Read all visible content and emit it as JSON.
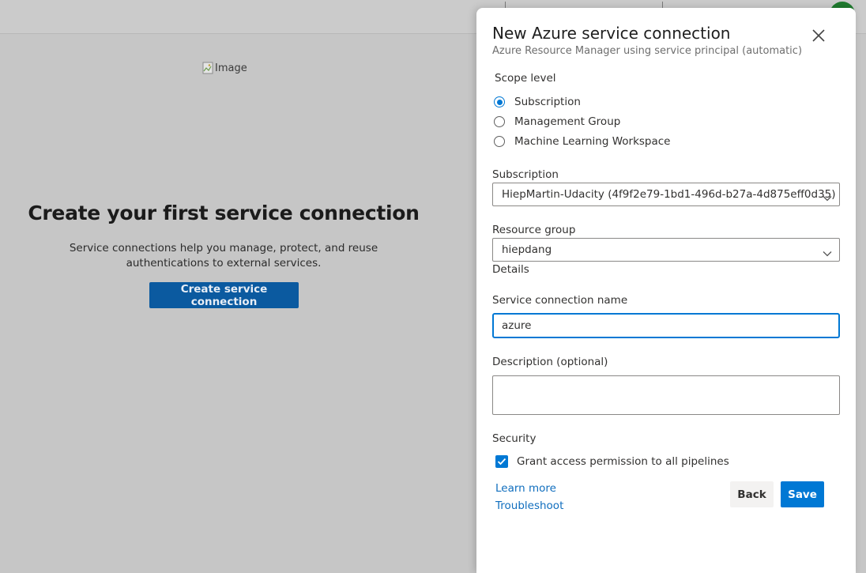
{
  "background": {
    "broken_image_alt": "Image",
    "empty_state_title": "Create your first service connection",
    "empty_state_description": "Service connections help you manage, protect, and reuse authentications to external services.",
    "create_button_label": "Create service connection"
  },
  "panel": {
    "title": "New Azure service connection",
    "subtitle": "Azure Resource Manager using service principal (automatic)",
    "close_icon": "close-icon",
    "scope_level": {
      "label": "Scope level",
      "options": [
        {
          "label": "Subscription",
          "selected": true
        },
        {
          "label": "Management Group",
          "selected": false
        },
        {
          "label": "Machine Learning Workspace",
          "selected": false
        }
      ]
    },
    "subscription": {
      "label": "Subscription",
      "value": "HiepMartin-Udacity (4f9f2e79-1bd1-496d-b27a-4d875eff0d35)"
    },
    "resource_group": {
      "label": "Resource group",
      "value": "hiepdang"
    },
    "details_label": "Details",
    "service_connection_name": {
      "label": "Service connection name",
      "value": "azure"
    },
    "description": {
      "label": "Description (optional)",
      "value": ""
    },
    "security": {
      "label": "Security",
      "grant_access_label": "Grant access permission to all pipelines",
      "grant_access_checked": true
    },
    "links": {
      "learn_more": "Learn more",
      "troubleshoot": "Troubleshoot"
    },
    "buttons": {
      "back": "Back",
      "save": "Save"
    }
  },
  "colors": {
    "accent": "#0078d4",
    "overlay_background": "#c6c6c6",
    "create_button": "#0b5aa0",
    "link": "#106ebe"
  }
}
